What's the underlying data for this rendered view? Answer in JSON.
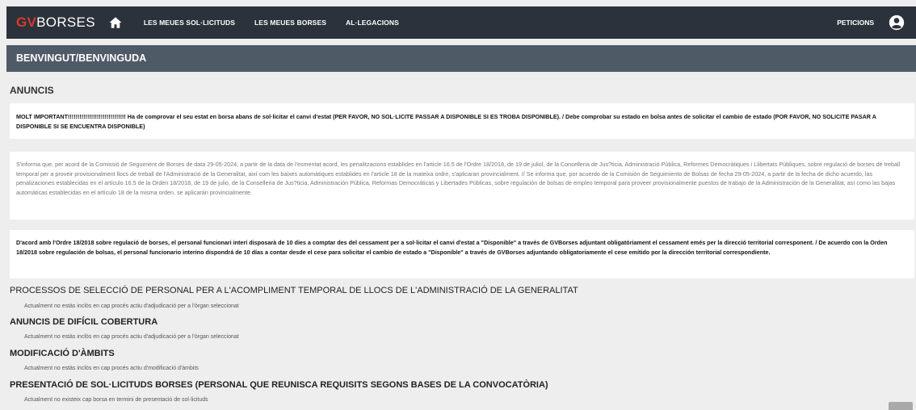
{
  "header": {
    "brand_prefix": "GV",
    "brand_suffix": "BORSES",
    "home_icon": "home-icon",
    "nav": [
      "LES MEUES SOL·LICITUDS",
      "LES MEUES BORSES",
      "AL·LEGACIONS"
    ],
    "peticions": "PETICIONS",
    "user_icon": "user-circle-icon"
  },
  "welcome": {
    "title": "BENVINGUT/BENVINGUDA"
  },
  "anuncis": {
    "title": "ANUNCIS",
    "notices": [
      "MOLT IMPORTANT!!!!!!!!!!!!!!!!!!!!!!!!!!!!!! Ha de comprovar el seu estat en borsa abans de sol·licitar el canvi d'estat (PER FAVOR, NO SOL·LICITE PASSAR A DISPONIBLE SI ES TROBA DISPONIBLE). / Debe comprobar su estado en bolsa antes de solicitar el cambio de estado (POR FAVOR, NO SOLICITE PASAR A DISPONIBLE SI SE ENCUENTRA DISPONIBLE)",
      "S'informa que, per acord de la Comissió de Seguiment de Borses de data 29-05-2024, a partir de la data de l'esmentat acord, les penalitzacions establides en l'article 16.5 de l'Ordre 18/2018, de 19 de juliol, de la Conselleria de Jus?ticia, Administració Pública, Reformes Democràtiques i Llibertats Públiques, sobre regulació de borses de treball temporal per a proveir provisionalment llocs de treball de l'Administració de la Generalitat, així com les baixes automàtiques establides en l'article 18 de la mateixa ordre, s'aplicaran provincialment. // Se informa que, por acuerdo de la Comisión de Seguimiento de Bolsas de fecha 29-05-2024, a partir de la fecha de dicho acuerdo, las penalizaciones establecidas en el artículo 16.5 de la Orden 18/2018, de 19 de julio, de la Conselleria de Jus?ticia, Administración Pública, Reformas Democráticas y Libertades Públicas, sobre regulación de bolsas de empleo temporal para proveer provisionalmente puestos de trabajo de la Administración de la Generalitat, así como las bajas automáticas establecidas en el artículo 18 de la misma orden, se aplicarán provincialmente.",
      "D'acord amb l'Ordre 18/2018 sobre regulació de borses, el personal funcionari interí disposarà de 10 dies a comptar des del cessament per a sol·licitar el canvi d'estat a \"Disponible\" a través de GVBorses adjuntant obligatòriament el cessament emés per la direcció territorial corresponent. / De acuerdo con la Orden 18/2018 sobre regulación de bolsas, el personal funcionario interino dispondrá de 10 días a contar desde el cese para solicitar el cambio de estado a \"Disponible\" a través de GVBorses adjuntando obligatoriamente el cese emitido por la dirección territorial correspondiente."
    ]
  },
  "sections": [
    {
      "title": "PROCESSOS DE SELECCIÓ DE PERSONAL PER A L'ACOMPLIMENT TEMPORAL DE LLOCS DE L'ADMINISTRACIÓ DE LA GENERALITAT",
      "text": "Actualment no estàs inclòs en cap procés actiu d'adjudicació per a l'òrgan seleccionat"
    },
    {
      "title": "ANUNCIS DE DIFÍCIL COBERTURA",
      "text": "Actualment no estàs inclòs en cap procés actiu d'adjudicació per a l'òrgan seleccionat"
    },
    {
      "title": "MODIFICACIÓ D'ÀMBITS",
      "text": "Actualment no estàs inclòs en cap procés actiu d'modificació d'àmbits"
    },
    {
      "title": "PRESENTACIÓ DE SOL·LICITUDS BORSES (PERSONAL QUE REUNISCA REQUISITS SEGONS BASES DE LA CONVOCATÒRIA)",
      "text": "Actualment no existeix cap borsa en termini de presentació de sol·licituds"
    }
  ]
}
